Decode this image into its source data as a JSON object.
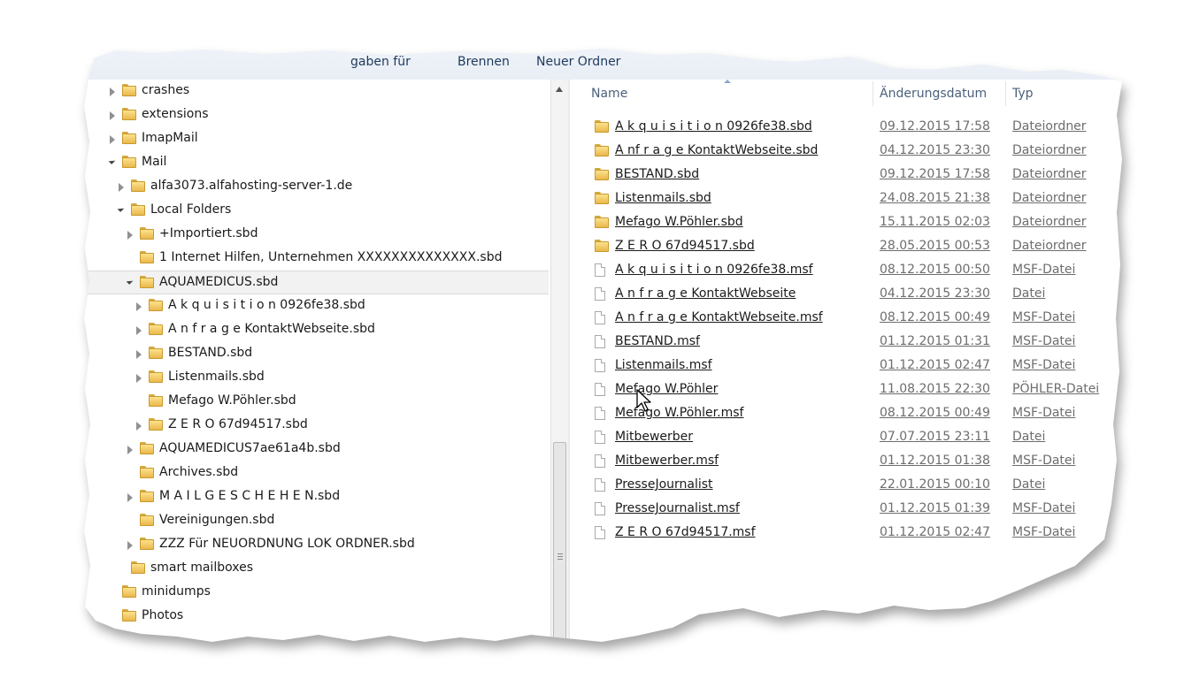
{
  "toolbar": {
    "partial_label": "gaben für",
    "burn_label": "Brennen",
    "new_folder_label": "Neuer Ordner"
  },
  "tree": [
    {
      "label": "crashes",
      "level": 0,
      "expander": "collapsed",
      "icon": "folder-icon"
    },
    {
      "label": "extensions",
      "level": 0,
      "expander": "collapsed",
      "icon": "folder-icon"
    },
    {
      "label": "ImapMail",
      "level": 0,
      "expander": "collapsed",
      "icon": "folder-icon"
    },
    {
      "label": "Mail",
      "level": 0,
      "expander": "expanded",
      "icon": "folder-icon"
    },
    {
      "label": "alfa3073.alfahosting-server-1.de",
      "level": 1,
      "expander": "collapsed",
      "icon": "folder-icon"
    },
    {
      "label": "Local Folders",
      "level": 1,
      "expander": "expanded",
      "icon": "folder-icon"
    },
    {
      "label": "+Importiert.sbd",
      "level": 2,
      "expander": "collapsed",
      "icon": "folder-icon"
    },
    {
      "label": "1 Internet Hilfen, Unternehmen XXXXXXXXXXXXXX.sbd",
      "level": 2,
      "expander": "none",
      "icon": "folder-icon"
    },
    {
      "label": "AQUAMEDICUS.sbd",
      "level": 2,
      "expander": "expanded",
      "icon": "folder-icon",
      "selected": true
    },
    {
      "label": "A k q u i s i t i o n 0926fe38.sbd",
      "level": 3,
      "expander": "collapsed",
      "icon": "folder-icon"
    },
    {
      "label": "A n f r a g e  KontaktWebseite.sbd",
      "level": 3,
      "expander": "collapsed",
      "icon": "folder-icon"
    },
    {
      "label": "BESTAND.sbd",
      "level": 3,
      "expander": "collapsed",
      "icon": "folder-icon"
    },
    {
      "label": "Listenmails.sbd",
      "level": 3,
      "expander": "collapsed",
      "icon": "folder-icon"
    },
    {
      "label": "Mefago W.Pöhler.sbd",
      "level": 3,
      "expander": "none",
      "icon": "folder-icon"
    },
    {
      "label": "Z E R O  67d94517.sbd",
      "level": 3,
      "expander": "collapsed",
      "icon": "folder-icon"
    },
    {
      "label": "AQUAMEDICUS7ae61a4b.sbd",
      "level": 2,
      "expander": "collapsed",
      "icon": "folder-icon"
    },
    {
      "label": "Archives.sbd",
      "level": 2,
      "expander": "none",
      "icon": "folder-icon"
    },
    {
      "label": "M A I L G E S C H E H E N.sbd",
      "level": 2,
      "expander": "collapsed",
      "icon": "folder-icon"
    },
    {
      "label": "Vereinigungen.sbd",
      "level": 2,
      "expander": "none",
      "icon": "folder-icon"
    },
    {
      "label": "ZZZ Für NEUORDNUNG LOK ORDNER.sbd",
      "level": 2,
      "expander": "collapsed",
      "icon": "folder-icon"
    },
    {
      "label": "smart mailboxes",
      "level": 1,
      "expander": "none",
      "icon": "folder-icon"
    },
    {
      "label": "minidumps",
      "level": 0,
      "expander": "none",
      "icon": "folder-icon"
    },
    {
      "label": "Photos",
      "level": 0,
      "expander": "none",
      "icon": "folder-icon"
    }
  ],
  "columns": {
    "name": "Name",
    "date": "Änderungsdatum",
    "type": "Typ"
  },
  "files": [
    {
      "name": "A k q u i s i t i o n 0926fe38.sbd",
      "date": "09.12.2015 17:58",
      "type": "Dateiordner",
      "icon": "folder-icon"
    },
    {
      "name": "A nf r a g e  KontaktWebseite.sbd",
      "date": "04.12.2015 23:30",
      "type": "Dateiordner",
      "icon": "folder-icon"
    },
    {
      "name": "BESTAND.sbd",
      "date": "09.12.2015 17:58",
      "type": "Dateiordner",
      "icon": "folder-icon"
    },
    {
      "name": "Listenmails.sbd",
      "date": "24.08.2015 21:38",
      "type": "Dateiordner",
      "icon": "folder-icon"
    },
    {
      "name": "Mefago W.Pöhler.sbd",
      "date": "15.11.2015 02:03",
      "type": "Dateiordner",
      "icon": "folder-icon"
    },
    {
      "name": "Z E R O  67d94517.sbd",
      "date": "28.05.2015 00:53",
      "type": "Dateiordner",
      "icon": "folder-icon"
    },
    {
      "name": "A k q u i s i t i o n 0926fe38.msf",
      "date": "08.12.2015 00:50",
      "type": "MSF-Datei",
      "icon": "file-icon"
    },
    {
      "name": "A n f r a g e  KontaktWebseite",
      "date": "04.12.2015 23:30",
      "type": "Datei",
      "icon": "file-icon"
    },
    {
      "name": "A n f r a g e  KontaktWebseite.msf",
      "date": "08.12.2015 00:49",
      "type": "MSF-Datei",
      "icon": "file-icon"
    },
    {
      "name": "BESTAND.msf",
      "date": "01.12.2015 01:31",
      "type": "MSF-Datei",
      "icon": "file-icon"
    },
    {
      "name": "Listenmails.msf",
      "date": "01.12.2015 02:47",
      "type": "MSF-Datei",
      "icon": "file-icon"
    },
    {
      "name": "Mefago W.Pöhler",
      "date": "11.08.2015 22:30",
      "type": "PÖHLER-Datei",
      "icon": "file-icon"
    },
    {
      "name": "Mefago W.Pöhler.msf",
      "date": "08.12.2015 00:49",
      "type": "MSF-Datei",
      "icon": "file-icon"
    },
    {
      "name": "Mitbewerber",
      "date": "07.07.2015 23:11",
      "type": "Datei",
      "icon": "file-icon"
    },
    {
      "name": "Mitbewerber.msf",
      "date": "01.12.2015 01:38",
      "type": "MSF-Datei",
      "icon": "file-icon"
    },
    {
      "name": "PresseJournalist",
      "date": "22.01.2015 00:10",
      "type": "Datei",
      "icon": "file-icon"
    },
    {
      "name": "PresseJournalist.msf",
      "date": "01.12.2015 01:39",
      "type": "MSF-Datei",
      "icon": "file-icon"
    },
    {
      "name": "Z E R O  67d94517.msf",
      "date": "01.12.2015 02:47",
      "type": "MSF-Datei",
      "icon": "file-icon"
    }
  ],
  "colors": {
    "folder": "#eab84c",
    "header_text": "#4c607a",
    "toolbar_text": "#1e395b",
    "secondary_text": "#6d6d6d"
  }
}
